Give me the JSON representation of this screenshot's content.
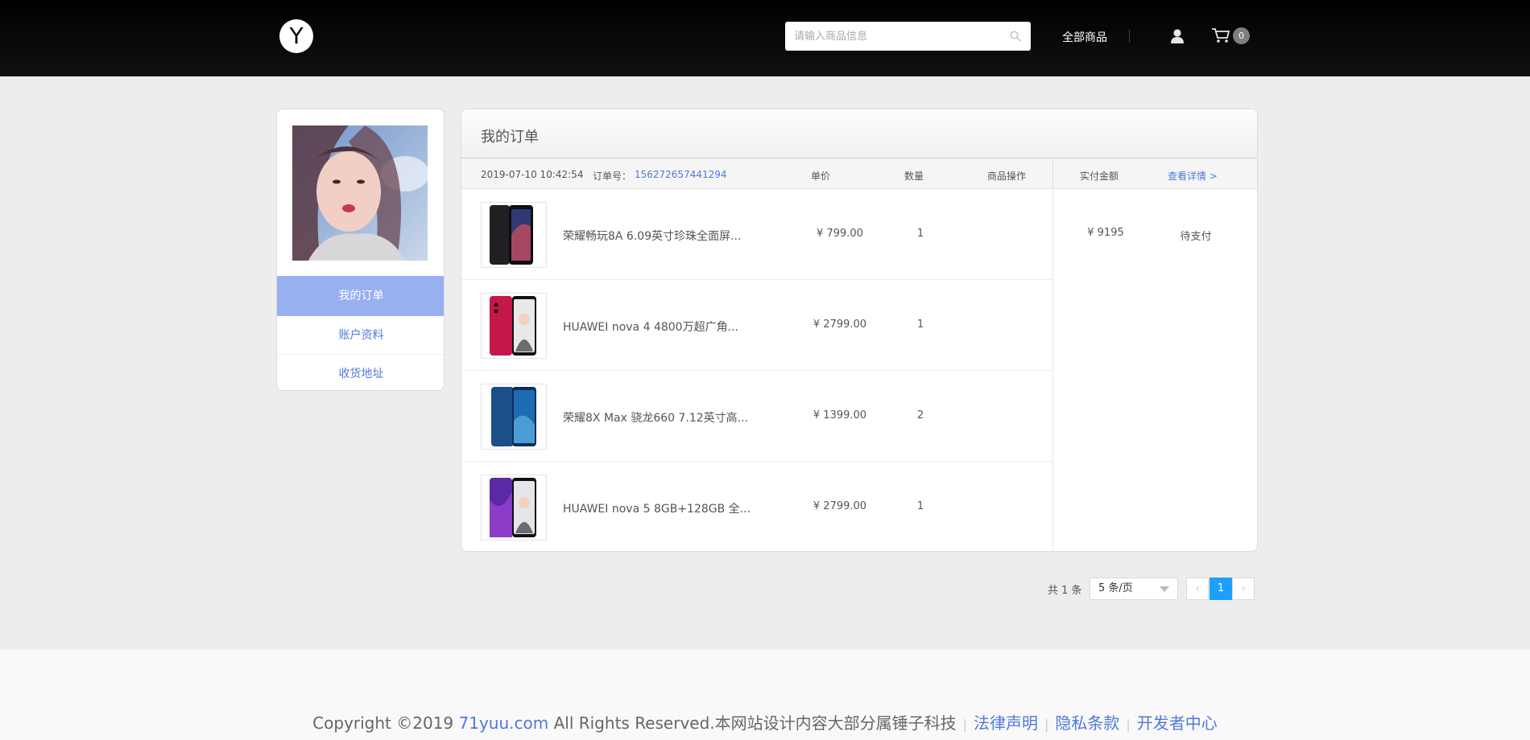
{
  "header": {
    "logo": "Y",
    "search_placeholder": "请输入商品信息",
    "all_products": "全部商品",
    "cart_count": "0"
  },
  "sidebar": {
    "items": [
      {
        "label": "我的订单",
        "active": true
      },
      {
        "label": "账户资料",
        "active": false
      },
      {
        "label": "收货地址",
        "active": false
      }
    ]
  },
  "orders": {
    "title": "我的订单",
    "order_time": "2019-07-10 10:42:54",
    "order_no_label": "订单号：",
    "order_no": "156272657441294",
    "col_price": "单价",
    "col_qty": "数量",
    "col_ops": "商品操作",
    "col_paid": "实付金额",
    "view_detail": "查看详情 >",
    "items": [
      {
        "name": "荣耀畅玩8A 6.09英寸珍珠全面屏...",
        "price": "¥ 799.00",
        "qty": "1",
        "color": "#2f3a74"
      },
      {
        "name": "HUAWEI nova 4 4800万超广角...",
        "price": "¥ 2799.00",
        "qty": "1",
        "color": "#c4184b"
      },
      {
        "name": "荣耀8X Max 骁龙660 7.12英寸高...",
        "price": "¥ 1399.00",
        "qty": "2",
        "color": "#1d6bb3"
      },
      {
        "name": "HUAWEI nova 5 8GB+128GB 全...",
        "price": "¥ 2799.00",
        "qty": "1",
        "color": "#5a2aa4"
      }
    ],
    "total": "¥ 9195",
    "status": "待支付"
  },
  "pagination": {
    "total": "共 1 条",
    "page_size": "5 条/页",
    "current": "1"
  },
  "footer": {
    "copyright_pre": "Copyright ©2019 ",
    "site": "71yuu.com",
    "copyright_post": " All Rights Reserved.本网站设计内容大部分属锤子科技",
    "legal": "法律声明",
    "privacy": "隐私条款",
    "developer": "开发者中心"
  }
}
